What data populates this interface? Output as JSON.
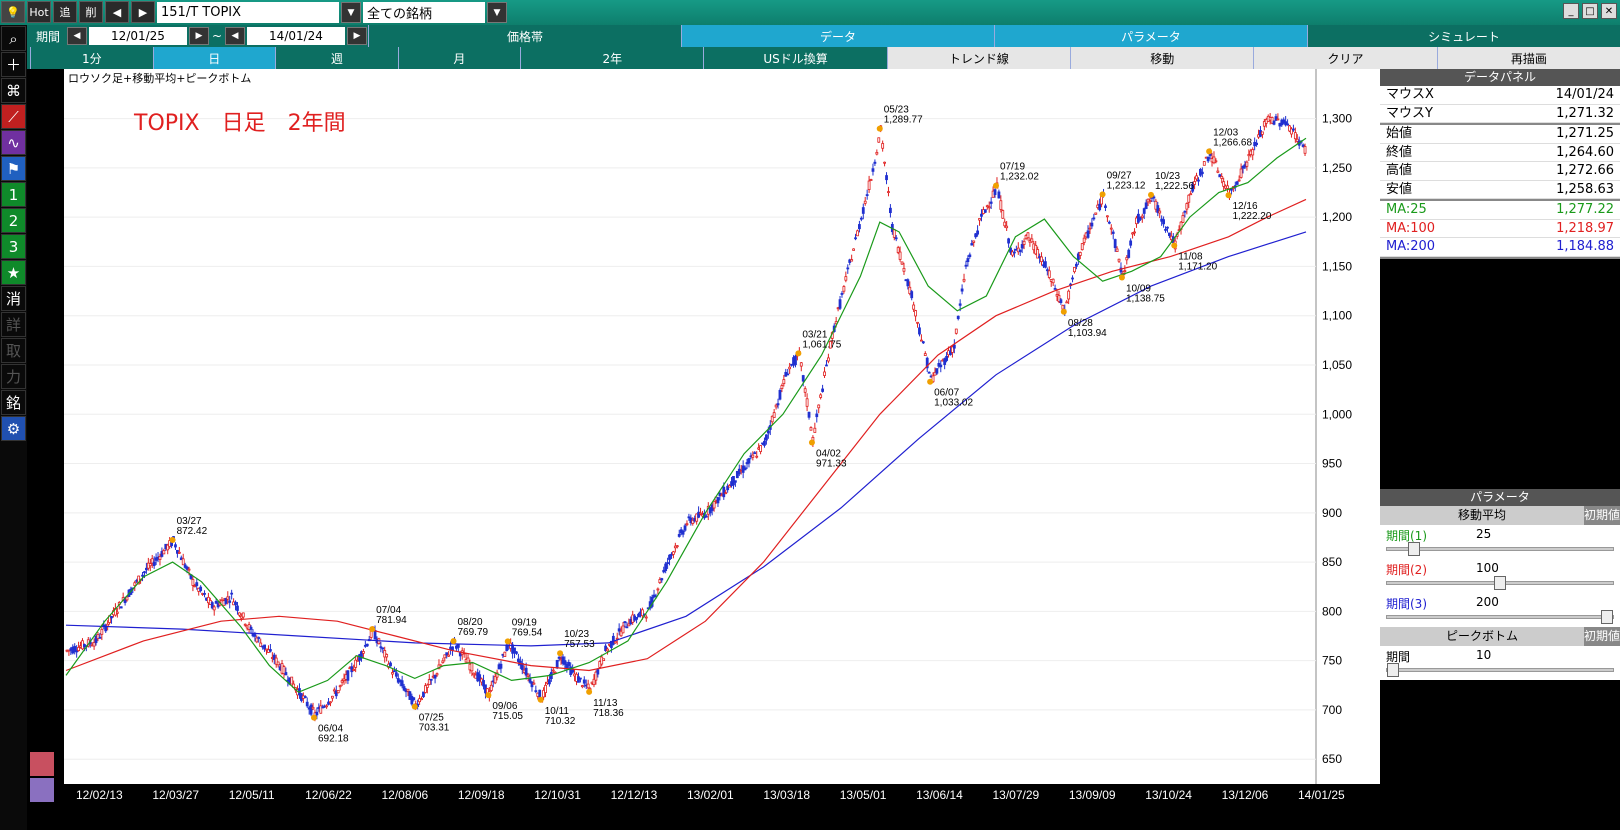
{
  "toolbar": {
    "hot": "Hot",
    "add": "追",
    "del": "削",
    "symbol": "151/T TOPIX",
    "universe": "全ての銘柄"
  },
  "period": {
    "label": "期間",
    "from": "12/01/25",
    "tilde": "~",
    "to": "14/01/24"
  },
  "mode_tabs": [
    "価格帯",
    "データ",
    "パラメータ",
    "シミュレート"
  ],
  "timeframe_tabs": [
    "1分",
    "日",
    "週",
    "月",
    "2年",
    "USドル換算",
    "トレンド線",
    "移動",
    "クリア",
    "再描画"
  ],
  "left_buttons": [
    "1",
    "2",
    "3",
    "★",
    "消",
    "詳",
    "取",
    "力",
    "銘"
  ],
  "chart_header": "ロウソク足+移動平均+ピークボトム",
  "chart_title": "TOPIX　日足　2年間",
  "data_panel": {
    "title": "データパネル",
    "mouse_x_label": "マウスX",
    "mouse_x": "14/01/24",
    "mouse_y_label": "マウスY",
    "mouse_y": "1,271.32",
    "open_label": "始値",
    "open": "1,271.25",
    "close_label": "終値",
    "close": "1,264.60",
    "high_label": "高値",
    "high": "1,272.66",
    "low_label": "安値",
    "low": "1,258.63",
    "ma25_label": "MA:25",
    "ma25": "1,277.22",
    "ma100_label": "MA:100",
    "ma100": "1,218.97",
    "ma200_label": "MA:200",
    "ma200": "1,184.88"
  },
  "param_panel": {
    "title": "パラメータ",
    "ma_header": "移動平均",
    "reset": "初期値",
    "p1_label": "期間(1)",
    "p1": "25",
    "p1_frac": 0.1,
    "p2_label": "期間(2)",
    "p2": "100",
    "p2_frac": 0.5,
    "p3_label": "期間(3)",
    "p3": "200",
    "p3_frac": 1.0,
    "pb_header": "ピークボトム",
    "pb_label": "期間",
    "pb": "10",
    "pb_frac": 0.0
  },
  "colors": {
    "ma25": "#1a9a1a",
    "ma100": "#e02020",
    "ma200": "#2020d0",
    "up": "#e02020",
    "down": "#2030d0",
    "teal": "#0c6f62"
  },
  "chart_data": {
    "type": "candlestick",
    "y_ticks": [
      "1,300",
      "1,250",
      "1,200",
      "1,150",
      "1,100",
      "1,050",
      "1,000",
      "950",
      "900",
      "850",
      "800",
      "750",
      "700",
      "650"
    ],
    "ylim": [
      635,
      1330
    ],
    "x_ticks": [
      "12/02/13",
      "12/03/27",
      "12/05/11",
      "12/06/22",
      "12/08/06",
      "12/09/18",
      "12/10/31",
      "12/12/13",
      "13/02/01",
      "13/03/18",
      "13/05/01",
      "13/06/14",
      "13/07/29",
      "13/09/09",
      "13/10/24",
      "13/12/06",
      "14/01/25"
    ],
    "ma25": [
      [
        0,
        735
      ],
      [
        20,
        790
      ],
      [
        40,
        835
      ],
      [
        55,
        850
      ],
      [
        70,
        830
      ],
      [
        90,
        785
      ],
      [
        105,
        745
      ],
      [
        120,
        718
      ],
      [
        135,
        730
      ],
      [
        150,
        755
      ],
      [
        165,
        745
      ],
      [
        180,
        732
      ],
      [
        195,
        745
      ],
      [
        210,
        748
      ],
      [
        230,
        730
      ],
      [
        250,
        735
      ],
      [
        270,
        748
      ],
      [
        290,
        770
      ],
      [
        310,
        830
      ],
      [
        330,
        900
      ],
      [
        350,
        960
      ],
      [
        370,
        1000
      ],
      [
        390,
        1060
      ],
      [
        410,
        1140
      ],
      [
        420,
        1195
      ],
      [
        430,
        1185
      ],
      [
        445,
        1130
      ],
      [
        460,
        1105
      ],
      [
        475,
        1120
      ],
      [
        490,
        1180
      ],
      [
        505,
        1198
      ],
      [
        520,
        1160
      ],
      [
        535,
        1135
      ],
      [
        550,
        1145
      ],
      [
        565,
        1160
      ],
      [
        580,
        1200
      ],
      [
        595,
        1225
      ],
      [
        610,
        1235
      ],
      [
        625,
        1260
      ],
      [
        640,
        1280
      ]
    ],
    "ma100": [
      [
        0,
        740
      ],
      [
        40,
        770
      ],
      [
        80,
        790
      ],
      [
        110,
        795
      ],
      [
        140,
        790
      ],
      [
        170,
        775
      ],
      [
        200,
        760
      ],
      [
        240,
        745
      ],
      [
        270,
        740
      ],
      [
        300,
        752
      ],
      [
        330,
        790
      ],
      [
        360,
        850
      ],
      [
        390,
        925
      ],
      [
        420,
        1000
      ],
      [
        450,
        1060
      ],
      [
        480,
        1100
      ],
      [
        510,
        1125
      ],
      [
        540,
        1145
      ],
      [
        570,
        1160
      ],
      [
        600,
        1180
      ],
      [
        620,
        1200
      ],
      [
        640,
        1218
      ]
    ],
    "ma200": [
      [
        0,
        786
      ],
      [
        60,
        782
      ],
      [
        120,
        775
      ],
      [
        180,
        768
      ],
      [
        240,
        765
      ],
      [
        280,
        768
      ],
      [
        320,
        795
      ],
      [
        360,
        845
      ],
      [
        400,
        905
      ],
      [
        440,
        975
      ],
      [
        480,
        1040
      ],
      [
        520,
        1090
      ],
      [
        560,
        1130
      ],
      [
        600,
        1160
      ],
      [
        640,
        1185
      ]
    ],
    "peaks": [
      {
        "i": 55,
        "v": 872.42,
        "date": "03/27",
        "val": "872.42",
        "pos": "top"
      },
      {
        "i": 128,
        "v": 692.18,
        "date": "06/04",
        "val": "692.18",
        "pos": "bottom"
      },
      {
        "i": 158,
        "v": 781.94,
        "date": "07/04",
        "val": "781.94",
        "pos": "top"
      },
      {
        "i": 180,
        "v": 703.31,
        "date": "07/25",
        "val": "703.31",
        "pos": "bottom"
      },
      {
        "i": 200,
        "v": 769.79,
        "date": "08/20",
        "val": "769.79",
        "pos": "top"
      },
      {
        "i": 218,
        "v": 715.05,
        "date": "09/06",
        "val": "715.05",
        "pos": "bottom"
      },
      {
        "i": 228,
        "v": 769.54,
        "date": "09/19",
        "val": "769.54",
        "pos": "top"
      },
      {
        "i": 245,
        "v": 710.32,
        "date": "10/11",
        "val": "710.32",
        "pos": "bottom"
      },
      {
        "i": 255,
        "v": 757.53,
        "date": "10/23",
        "val": "757.53",
        "pos": "top"
      },
      {
        "i": 270,
        "v": 718.36,
        "date": "11/13",
        "val": "718.36",
        "pos": "bottom"
      },
      {
        "i": 378,
        "v": 1061.75,
        "date": "03/21",
        "val": "1,061.75",
        "pos": "top"
      },
      {
        "i": 385,
        "v": 971.33,
        "date": "04/02",
        "val": "971.33",
        "pos": "bottom"
      },
      {
        "i": 420,
        "v": 1289.77,
        "date": "05/23",
        "val": "1,289.77",
        "pos": "top"
      },
      {
        "i": 446,
        "v": 1033.02,
        "date": "06/07",
        "val": "1,033.02",
        "pos": "bottom"
      },
      {
        "i": 480,
        "v": 1232.02,
        "date": "07/19",
        "val": "1,232.02",
        "pos": "top"
      },
      {
        "i": 515,
        "v": 1103.94,
        "date": "08/28",
        "val": "1,103.94",
        "pos": "bottom"
      },
      {
        "i": 535,
        "v": 1223.12,
        "date": "09/27",
        "val": "1,223.12",
        "pos": "top"
      },
      {
        "i": 545,
        "v": 1138.75,
        "date": "10/09",
        "val": "1,138.75",
        "pos": "bottom"
      },
      {
        "i": 560,
        "v": 1222.56,
        "date": "10/23",
        "val": "1,222.56",
        "pos": "top"
      },
      {
        "i": 572,
        "v": 1171.2,
        "date": "11/08",
        "val": "1,171.20",
        "pos": "bottom"
      },
      {
        "i": 590,
        "v": 1266.68,
        "date": "12/03",
        "val": "1,266.68",
        "pos": "top"
      },
      {
        "i": 600,
        "v": 1222.2,
        "date": "12/16",
        "val": "1,222.20",
        "pos": "bottom"
      }
    ],
    "price_path": [
      [
        0,
        760
      ],
      [
        15,
        770
      ],
      [
        25,
        800
      ],
      [
        40,
        840
      ],
      [
        55,
        872
      ],
      [
        65,
        830
      ],
      [
        75,
        805
      ],
      [
        85,
        815
      ],
      [
        95,
        780
      ],
      [
        110,
        745
      ],
      [
        128,
        695
      ],
      [
        140,
        720
      ],
      [
        150,
        750
      ],
      [
        158,
        780
      ],
      [
        168,
        740
      ],
      [
        180,
        705
      ],
      [
        190,
        735
      ],
      [
        200,
        768
      ],
      [
        210,
        740
      ],
      [
        218,
        716
      ],
      [
        228,
        768
      ],
      [
        238,
        735
      ],
      [
        245,
        712
      ],
      [
        255,
        755
      ],
      [
        262,
        735
      ],
      [
        270,
        720
      ],
      [
        278,
        760
      ],
      [
        290,
        790
      ],
      [
        300,
        800
      ],
      [
        310,
        850
      ],
      [
        320,
        890
      ],
      [
        330,
        900
      ],
      [
        345,
        935
      ],
      [
        360,
        970
      ],
      [
        372,
        1045
      ],
      [
        378,
        1060
      ],
      [
        385,
        975
      ],
      [
        395,
        1080
      ],
      [
        405,
        1160
      ],
      [
        415,
        1240
      ],
      [
        420,
        1288
      ],
      [
        426,
        1190
      ],
      [
        436,
        1120
      ],
      [
        446,
        1035
      ],
      [
        458,
        1070
      ],
      [
        464,
        1150
      ],
      [
        472,
        1200
      ],
      [
        480,
        1230
      ],
      [
        488,
        1160
      ],
      [
        496,
        1180
      ],
      [
        505,
        1150
      ],
      [
        515,
        1105
      ],
      [
        522,
        1160
      ],
      [
        535,
        1222
      ],
      [
        545,
        1140
      ],
      [
        552,
        1195
      ],
      [
        560,
        1220
      ],
      [
        572,
        1172
      ],
      [
        580,
        1225
      ],
      [
        590,
        1265
      ],
      [
        600,
        1223
      ],
      [
        610,
        1260
      ],
      [
        620,
        1300
      ],
      [
        630,
        1295
      ],
      [
        640,
        1265
      ]
    ],
    "n": 640
  }
}
